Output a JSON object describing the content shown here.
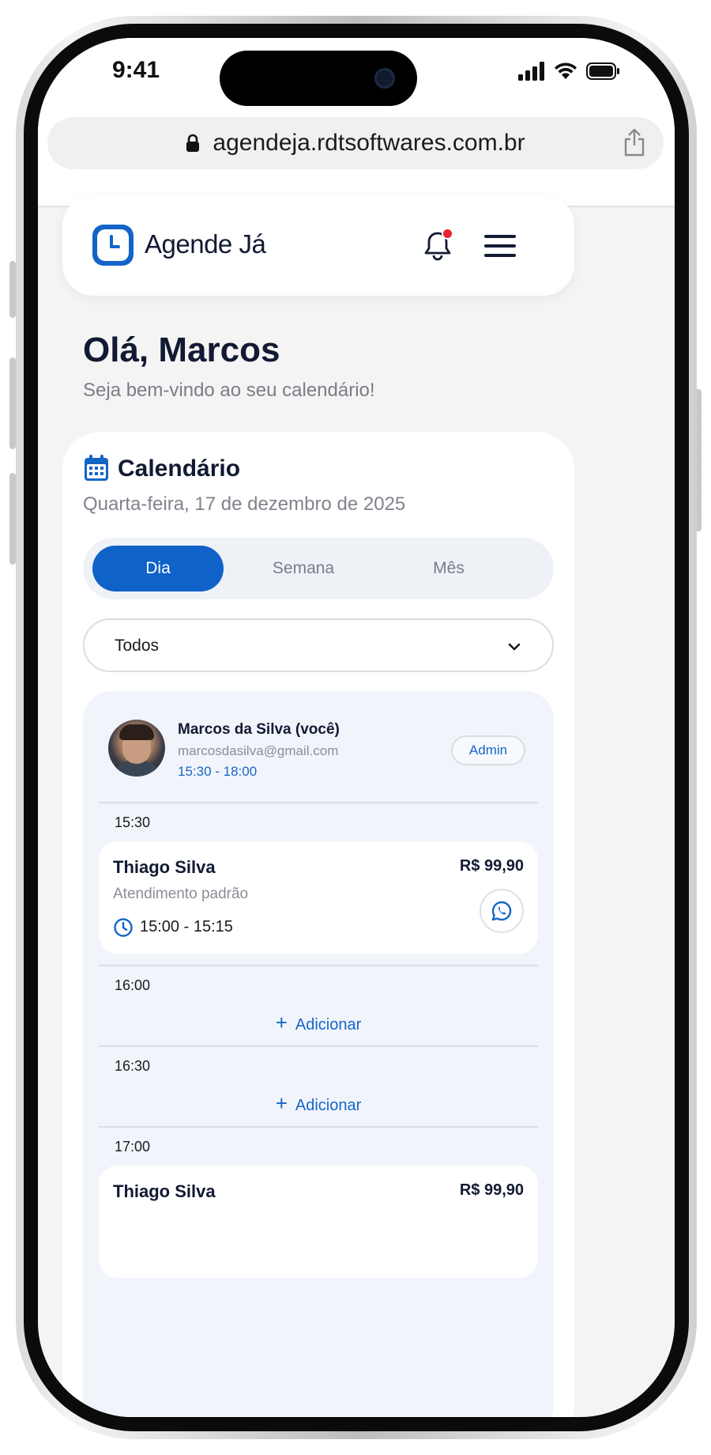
{
  "status_bar": {
    "time": "9:41"
  },
  "browser": {
    "url": "agendeja.rdtsoftwares.com.br"
  },
  "app": {
    "name": "Agende Já",
    "brand_color": "#0f62c8",
    "notification_dot_color": "#e8242f"
  },
  "greeting": {
    "title": "Olá, Marcos",
    "subtitle": "Seja bem-vindo ao seu calendário!"
  },
  "calendar": {
    "title": "Calendário",
    "date": "Quarta-feira, 17 de dezembro de 2025",
    "views": [
      "Dia",
      "Semana",
      "Mês"
    ],
    "active_view": "Dia",
    "filter": {
      "selected": "Todos"
    }
  },
  "staff": {
    "name": "Marcos da Silva (você)",
    "email": "marcosdasilva@gmail.com",
    "hours": "15:30 - 18:00",
    "role": "Admin"
  },
  "slots": [
    {
      "time": "15:30",
      "appointment": {
        "client": "Thiago Silva",
        "price": "R$ 99,90",
        "service": "Atendimento padrão",
        "time_range": "15:00 - 15:15"
      }
    },
    {
      "time": "16:00",
      "add_label": "Adicionar"
    },
    {
      "time": "16:30",
      "add_label": "Adicionar"
    },
    {
      "time": "17:00",
      "appointment": {
        "client": "Thiago Silva",
        "price": "R$ 99,90"
      }
    }
  ]
}
